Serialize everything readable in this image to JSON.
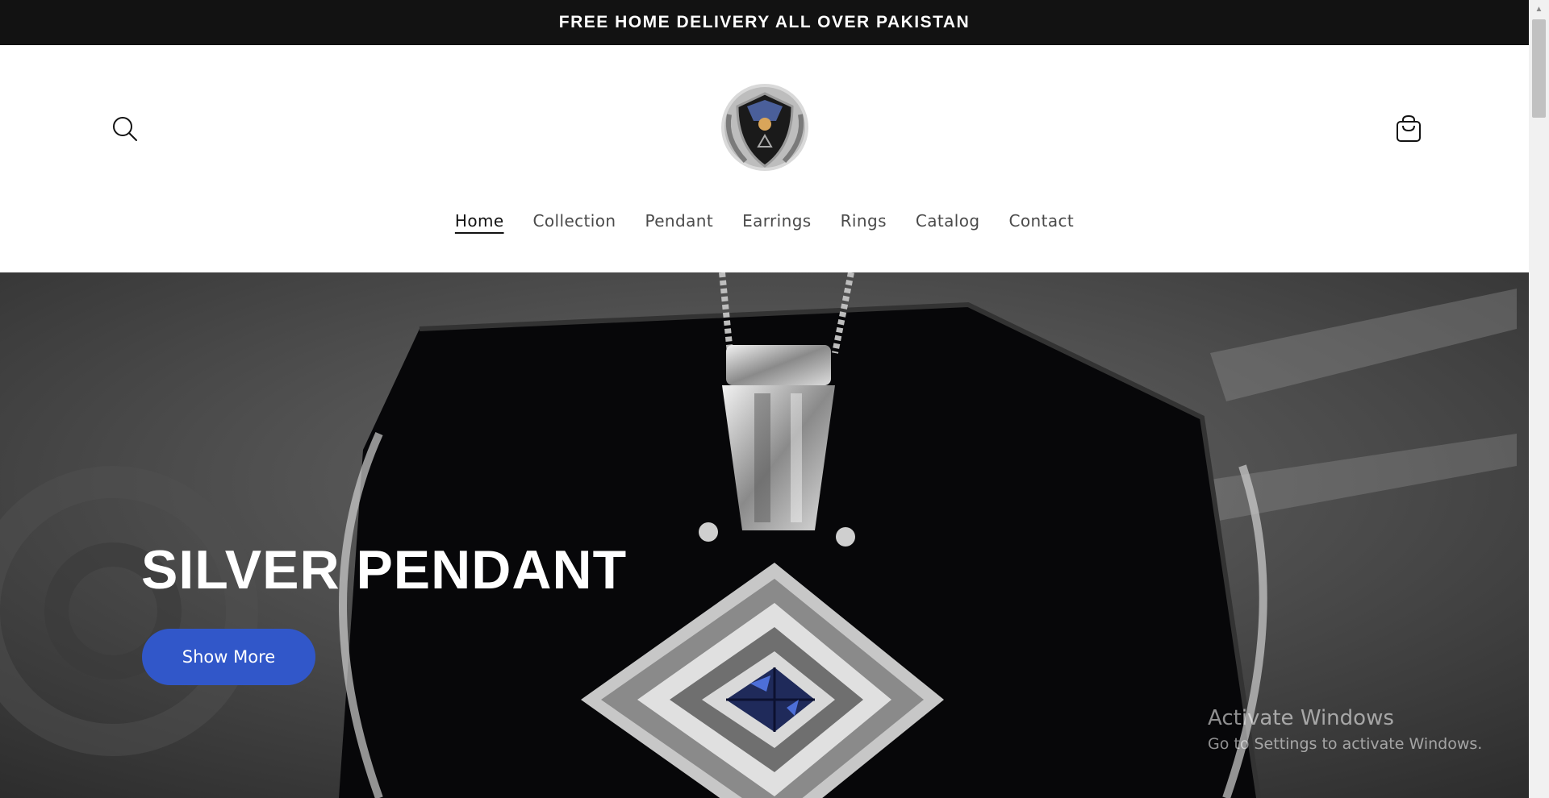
{
  "announcement": {
    "text": "FREE HOME DELIVERY ALL OVER PAKISTAN"
  },
  "header": {
    "logo": {
      "icon": "shield-crest-logo-icon"
    },
    "search": {
      "icon": "search-icon"
    },
    "cart": {
      "icon": "shopping-bag-icon"
    }
  },
  "nav": {
    "items": [
      {
        "label": "Home",
        "active": true
      },
      {
        "label": "Collection"
      },
      {
        "label": "Pendant"
      },
      {
        "label": "Earrings"
      },
      {
        "label": "Rings"
      },
      {
        "label": "Catalog"
      },
      {
        "label": "Contact"
      }
    ]
  },
  "hero": {
    "title": "SILVER PENDANT",
    "button_label": "Show More",
    "button_color": "#3157c9"
  },
  "watermark": {
    "title": "Activate Windows",
    "subtitle": "Go to Settings to activate Windows."
  },
  "colors": {
    "announcement_bg": "#121212",
    "accent": "#3157c9"
  }
}
